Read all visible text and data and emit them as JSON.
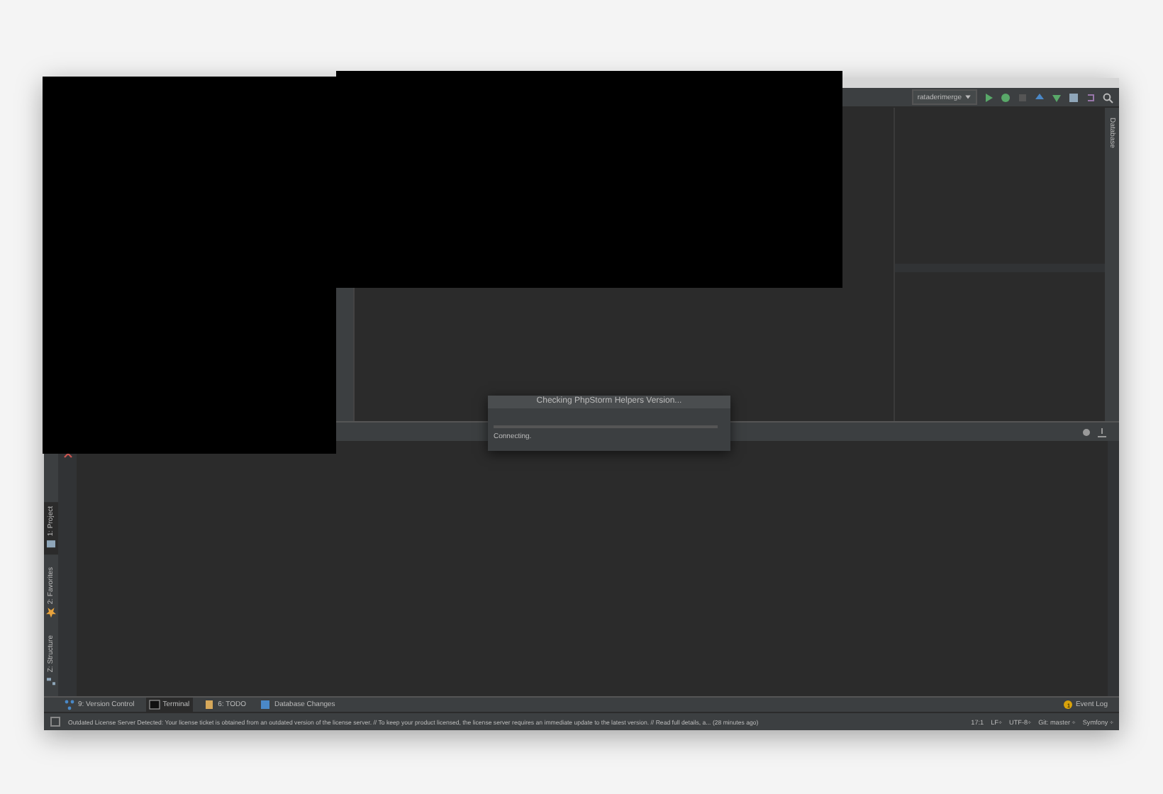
{
  "toolbar": {
    "run_config": "rataderimerge"
  },
  "right_stripe": {
    "tabs": [
      {
        "label": "Database",
        "selected": false
      }
    ]
  },
  "left_stripe": {
    "tabs": [
      {
        "label": "1: Project",
        "selected": true,
        "kind": "project"
      },
      {
        "label": "2: Favorites",
        "selected": false,
        "kind": "favorites"
      },
      {
        "label": "Z: Structure",
        "selected": false,
        "kind": "structure"
      }
    ]
  },
  "dialog": {
    "title": "Checking PhpStorm Helpers Version...",
    "message": "Connecting."
  },
  "tool_buttons": [
    {
      "label": "9: Version Control",
      "selected": false,
      "kind": "vcs"
    },
    {
      "label": "Terminal",
      "selected": true,
      "kind": "terminal"
    },
    {
      "label": "6: TODO",
      "selected": false,
      "kind": "todo"
    },
    {
      "label": "Database Changes",
      "selected": false,
      "kind": "database"
    }
  ],
  "event_log": {
    "label": "Event Log",
    "count": "1"
  },
  "status_bar": {
    "message": "Outdated License Server Detected: Your license ticket is obtained from an outdated version of the license server. // To keep your product licensed, the license server requires an immediate update to the latest version. // Read full details, a... (28 minutes ago)",
    "items": [
      "17:1",
      "LF÷",
      "UTF-8÷",
      "Git: master ÷",
      "Symfony ÷"
    ]
  }
}
